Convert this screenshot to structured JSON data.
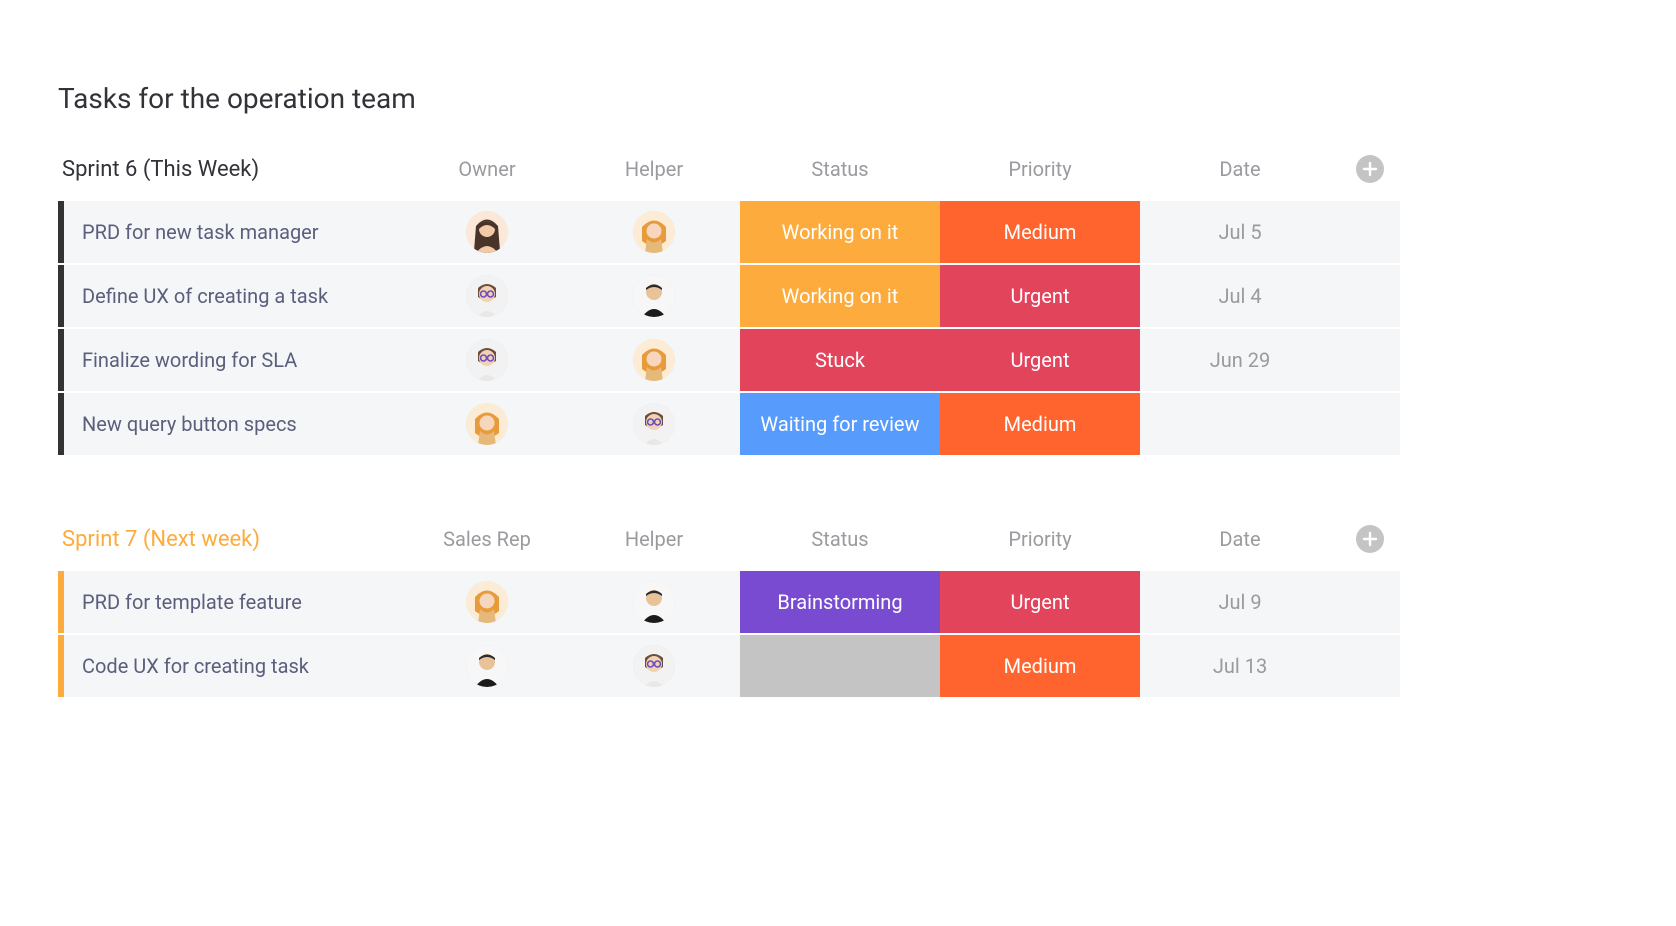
{
  "page": {
    "title": "Tasks for the operation team"
  },
  "colors": {
    "accent_dark": "#333333",
    "accent_orange": "#fdab3d",
    "status_working": "#fdab3d",
    "status_stuck": "#e2445c",
    "status_waiting": "#579bfc",
    "status_brainstorm": "#784bd1",
    "status_empty": "#c4c4c4",
    "priority_medium": "#ff642e",
    "priority_urgent": "#e2445c"
  },
  "groups": [
    {
      "title": "Sprint 6 (This Week)",
      "title_style": "dark",
      "accent": "#333333",
      "columns": [
        "Owner",
        "Helper",
        "Status",
        "Priority",
        "Date"
      ],
      "rows": [
        {
          "task": "PRD for new task manager",
          "owner_avatar": "person-a",
          "helper_avatar": "person-b",
          "status_label": "Working on it",
          "status_color": "#fdab3d",
          "priority_label": "Medium",
          "priority_color": "#ff642e",
          "date": "Jul 5"
        },
        {
          "task": "Define UX of creating a task",
          "owner_avatar": "person-c",
          "helper_avatar": "person-d",
          "status_label": "Working on it",
          "status_color": "#fdab3d",
          "priority_label": "Urgent",
          "priority_color": "#e2445c",
          "date": "Jul 4"
        },
        {
          "task": "Finalize wording for SLA",
          "owner_avatar": "person-c",
          "helper_avatar": "person-b",
          "status_label": "Stuck",
          "status_color": "#e2445c",
          "priority_label": "Urgent",
          "priority_color": "#e2445c",
          "date": "Jun 29"
        },
        {
          "task": "New query button specs",
          "owner_avatar": "person-b",
          "helper_avatar": "person-c",
          "status_label": "Waiting for review",
          "status_color": "#579bfc",
          "priority_label": "Medium",
          "priority_color": "#ff642e",
          "date": ""
        }
      ]
    },
    {
      "title": "Sprint 7 (Next week)",
      "title_style": "orange",
      "accent": "#fdab3d",
      "columns": [
        "Sales Rep",
        "Helper",
        "Status",
        "Priority",
        "Date"
      ],
      "rows": [
        {
          "task": "PRD for template feature",
          "owner_avatar": "person-b",
          "helper_avatar": "person-d",
          "status_label": "Brainstorming",
          "status_color": "#784bd1",
          "priority_label": "Urgent",
          "priority_color": "#e2445c",
          "date": "Jul 9"
        },
        {
          "task": "Code UX for creating task",
          "owner_avatar": "person-d",
          "helper_avatar": "person-c",
          "status_label": "",
          "status_color": "#c4c4c4",
          "priority_label": "Medium",
          "priority_color": "#ff642e",
          "date": "Jul 13"
        }
      ]
    }
  ]
}
